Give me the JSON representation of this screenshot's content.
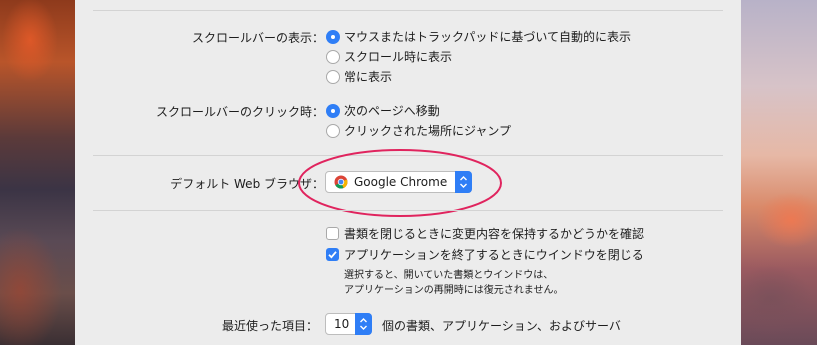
{
  "scrollbar_display": {
    "label": "スクロールバーの表示：",
    "options": [
      {
        "label": "マウスまたはトラックパッドに基づいて自動的に表示",
        "selected": true
      },
      {
        "label": "スクロール時に表示",
        "selected": false
      },
      {
        "label": "常に表示",
        "selected": false
      }
    ]
  },
  "scrollbar_click": {
    "label": "スクロールバーのクリック時：",
    "options": [
      {
        "label": "次のページへ移動",
        "selected": true
      },
      {
        "label": "クリックされた場所にジャンプ",
        "selected": false
      }
    ]
  },
  "default_browser": {
    "label": "デフォルト Web ブラウザ：",
    "value": "Google Chrome",
    "icon": "chrome-icon"
  },
  "documents": {
    "ask_keep_changes": {
      "label": "書類を閉じるときに変更内容を保持するかどうかを確認",
      "checked": false
    },
    "close_windows": {
      "label": "アプリケーションを終了するときにウインドウを閉じる",
      "checked": true
    },
    "note_line1": "選択すると、開いていた書類とウインドウは、",
    "note_line2": "アプリケーションの再開時には復元されません。"
  },
  "recent_items": {
    "label": "最近使った項目：",
    "value": "10",
    "suffix": "個の書類、アプリケーション、およびサーバ"
  },
  "colors": {
    "accent": "#2f7ef6",
    "annotation": "#e0245e"
  }
}
